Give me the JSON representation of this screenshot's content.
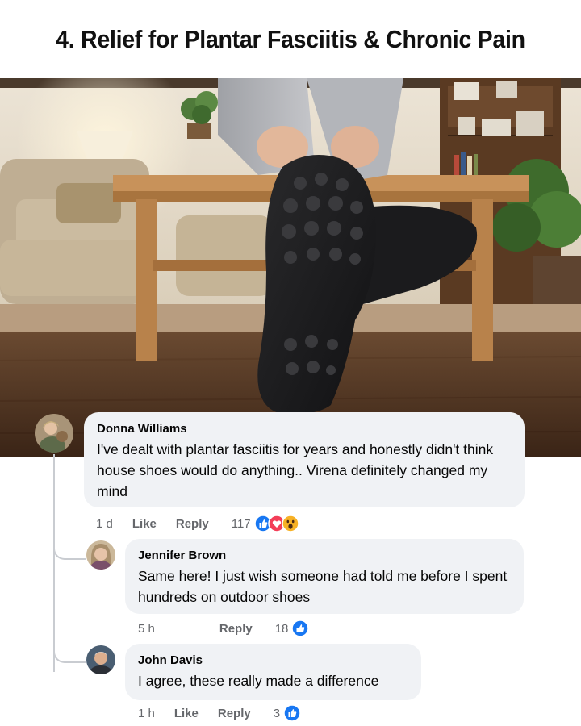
{
  "headline": "4. Relief for Plantar Fasciitis & Chronic Pain",
  "comments": [
    {
      "author": "Donna Williams",
      "text": "I've dealt with plantar fasciitis for years and honestly didn't think house shoes would do anything.. Virena definitely changed my mind",
      "time": "1 d",
      "like_label": "Like",
      "reply_label": "Reply",
      "reaction_count": "117",
      "reactions": [
        "like-icon",
        "love-icon",
        "wow-icon"
      ]
    },
    {
      "author": "Jennifer Brown",
      "text": "Same here! I just wish someone had told me before I spent hundreds on outdoor shoes",
      "time": "5 h",
      "reply_label": "Reply",
      "reaction_count": "18",
      "reactions": [
        "like-icon"
      ]
    },
    {
      "author": "John Davis",
      "text": "I agree, these really made a difference",
      "time": "1 h",
      "like_label": "Like",
      "reply_label": "Reply",
      "reaction_count": "3",
      "reactions": [
        "like-icon"
      ]
    }
  ],
  "colors": {
    "bubble": "#f0f2f5",
    "meta_text": "#65676b",
    "like_blue": "#1877f2",
    "love_red": "#f33e58",
    "wow_yellow": "#f7b125"
  }
}
